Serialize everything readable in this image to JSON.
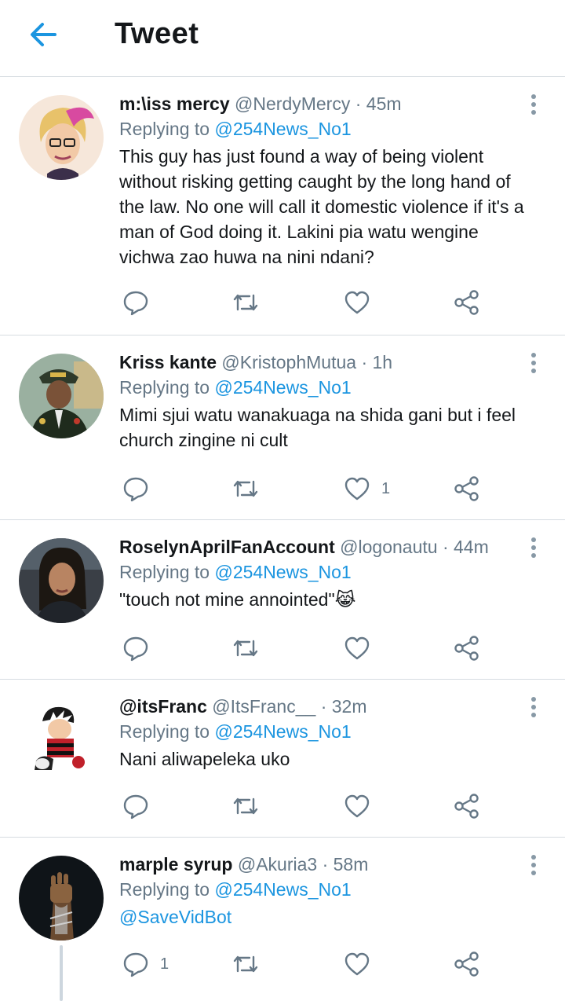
{
  "header": {
    "title": "Tweet",
    "back_icon": "arrow-left-icon"
  },
  "colors": {
    "accent": "#1b95e0",
    "text": "#14171a",
    "muted": "#657786",
    "divider": "#d6dce1"
  },
  "tweets": [
    {
      "name": "m:\\iss mercy",
      "handle": "@NerdyMercy",
      "time": "· 45m",
      "replying_label": "Replying to",
      "replying_to": "@254News_No1",
      "text": "This guy has just found a way of being violent without risking getting caught by the long hand of the law. No one will call it domestic violence if it's a man of God doing it. Lakini pia watu wengine vichwa zao huwa na nini ndani?",
      "reply_count": "",
      "retweet_count": "",
      "like_count": ""
    },
    {
      "name": "Kriss kante",
      "handle": "@KristophMutua",
      "time": "· 1h",
      "replying_label": "Replying to",
      "replying_to": "@254News_No1",
      "text": "Mimi sjui watu wanakuaga na shida gani but i feel church zingine ni cult",
      "reply_count": "",
      "retweet_count": "",
      "like_count": "1"
    },
    {
      "name": "RoselynAprilFanAccount",
      "handle": "@logonautu",
      "time": "· 44m",
      "replying_label": "Replying to",
      "replying_to": "@254News_No1",
      "text": "\"touch not mine annointed\"😹",
      "reply_count": "",
      "retweet_count": "",
      "like_count": ""
    },
    {
      "name": "@itsFranc",
      "handle": "@ItsFranc__",
      "time": "· 32m",
      "replying_label": "Replying to",
      "replying_to": "@254News_No1",
      "text": "Nani aliwapeleka uko",
      "reply_count": "",
      "retweet_count": "",
      "like_count": ""
    },
    {
      "name": "marple syrup",
      "handle": "@Akuria3",
      "time": "· 58m",
      "replying_label": "Replying to",
      "replying_to": "@254News_No1",
      "text": "@SaveVidBot",
      "reply_count": "1",
      "retweet_count": "",
      "like_count": ""
    }
  ]
}
